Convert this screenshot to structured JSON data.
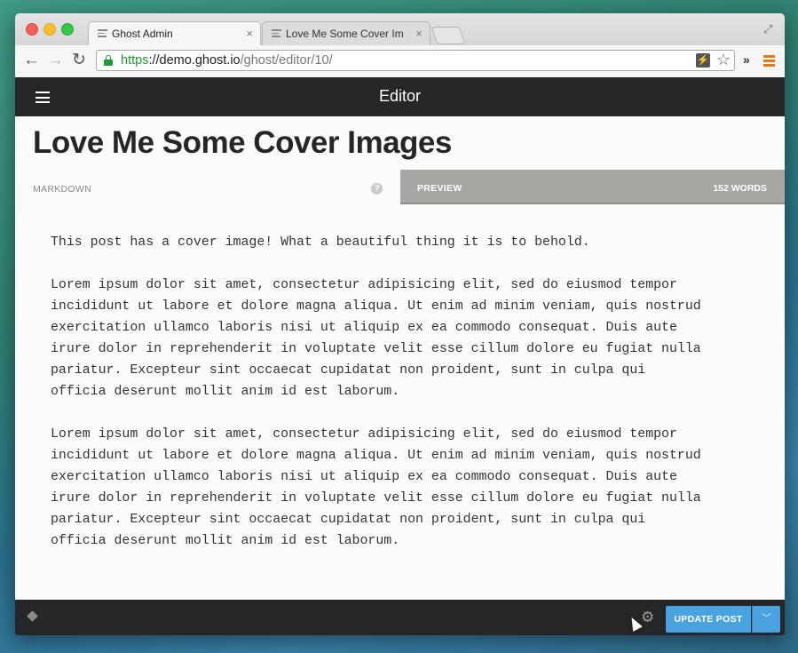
{
  "browser": {
    "tabs": [
      {
        "title": "Ghost Admin",
        "active": true
      },
      {
        "title": "Love Me Some Cover Images",
        "active": false
      }
    ],
    "url": {
      "scheme": "https",
      "separator": "://",
      "host": "demo.ghost.io",
      "path": "/ghost/editor/10/"
    },
    "close_glyph": "×",
    "overflow_glyph": "»"
  },
  "header": {
    "title": "Editor"
  },
  "editor": {
    "post_title": "Love Me Some Cover Images",
    "markdown_label": "MARKDOWN",
    "help_glyph": "?",
    "preview_label": "PREVIEW",
    "word_count": "152 WORDS",
    "paragraphs": [
      "This post has a cover image! What a beautiful thing it is to behold.",
      "Lorem ipsum dolor sit amet, consectetur adipisicing elit, sed do eiusmod tempor\nincididunt ut labore et dolore magna aliqua. Ut enim ad minim veniam, quis nostrud\nexercitation ullamco laboris nisi ut aliquip ex ea commodo consequat. Duis aute\nirure dolor in reprehenderit in voluptate velit esse cillum dolore eu fugiat nulla\npariatur. Excepteur sint occaecat cupidatat non proident, sunt in culpa qui\nofficia deserunt mollit anim id est laborum.",
      "Lorem ipsum dolor sit amet, consectetur adipisicing elit, sed do eiusmod tempor\nincididunt ut labore et dolore magna aliqua. Ut enim ad minim veniam, quis nostrud\nexercitation ullamco laboris nisi ut aliquip ex ea commodo consequat. Duis aute\nirure dolor in reprehenderit in voluptate velit esse cillum dolore eu fugiat nulla\npariatur. Excepteur sint occaecat cupidatat non proident, sunt in culpa qui\nofficia deserunt mollit anim id est laborum."
    ]
  },
  "footer": {
    "update_button": "UPDATE POST"
  },
  "colors": {
    "header_bg": "#242628",
    "accent": "#4aa3df",
    "preview_bar": "#a8a7a3",
    "secure_green": "#1e9b33"
  }
}
